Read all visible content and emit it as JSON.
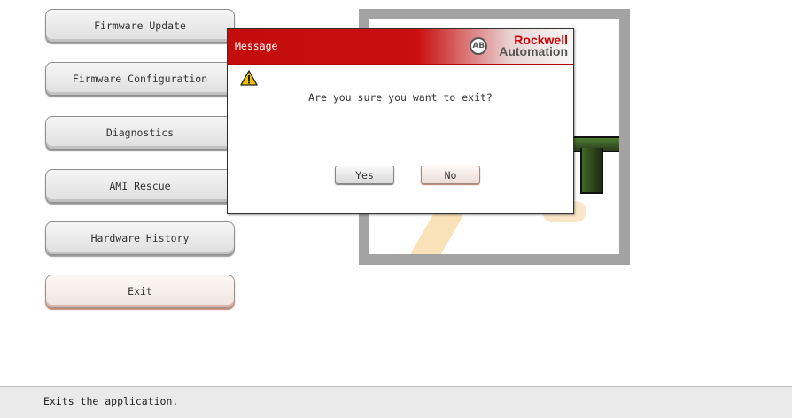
{
  "menu": {
    "items": [
      {
        "label": "Firmware Update"
      },
      {
        "label": "Firmware Configuration"
      },
      {
        "label": "Diagnostics"
      },
      {
        "label": "AMI Rescue"
      },
      {
        "label": "Hardware History"
      },
      {
        "label": "Exit"
      }
    ]
  },
  "dialog": {
    "title": "Message",
    "message": "Are you sure you want to exit?",
    "yes_label": "Yes",
    "no_label": "No",
    "icon": "warning-icon",
    "brand_line1": "Rockwell",
    "brand_line2": "Automation",
    "brand_badge": "AB"
  },
  "status": {
    "text": "Exits the application."
  },
  "colors": {
    "title_red": "#c30c0c",
    "panel_gray": "#a3a3a3",
    "status_bg": "#eaeaea"
  }
}
